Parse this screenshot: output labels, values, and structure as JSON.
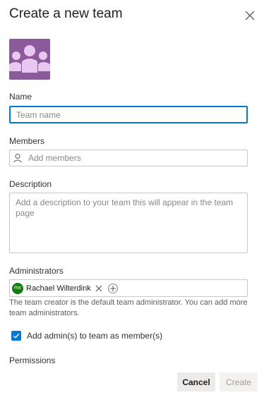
{
  "dialog": {
    "title": "Create a new team"
  },
  "form": {
    "name_label": "Name",
    "name_placeholder": "Team name",
    "members_label": "Members",
    "members_placeholder": "Add members",
    "description_label": "Description",
    "description_placeholder": "Add a description to your team this will appear in the team page",
    "administrators_label": "Administrators",
    "admin": {
      "initials": "RW",
      "name": "Rachael Wilterdink"
    },
    "admin_help": "The team creator is the default team administrator. You can add more team administrators.",
    "add_admins_as_members_label": "Add admin(s) to team as member(s)",
    "add_admins_as_members_checked": true,
    "permissions_label": "Permissions"
  },
  "footer": {
    "cancel_label": "Cancel",
    "create_label": "Create"
  },
  "icons": {
    "close": "close-icon",
    "team_avatar": "team-icon",
    "person": "person-icon",
    "remove": "remove-icon",
    "add": "add-icon",
    "check": "checkmark-icon"
  },
  "colors": {
    "accent": "#0078d4",
    "team_avatar_bg": "#8a5a9b",
    "admin_avatar_bg": "#107c10"
  }
}
